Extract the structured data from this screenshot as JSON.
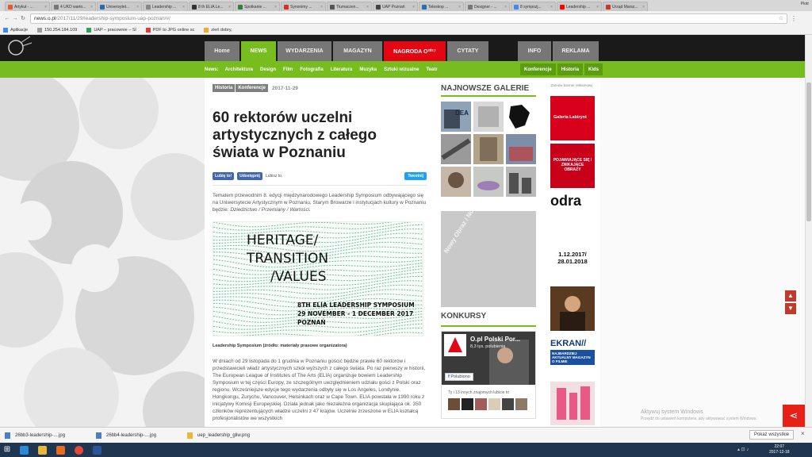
{
  "browser": {
    "tabs": [
      {
        "label": "Artykuł - ...",
        "color": "#e05a2b"
      },
      {
        "label": "4 UKD warto...",
        "color": "#777777"
      },
      {
        "label": "Universytet...",
        "color": "#2b6cb0"
      },
      {
        "label": "Leadership ...",
        "color": "#888888"
      },
      {
        "label": "8 th ELIA Le...",
        "color": "#333333"
      },
      {
        "label": "Spotkanie ...",
        "color": "#3b7a3b"
      },
      {
        "label": "Synonimy ...",
        "color": "#d93025"
      },
      {
        "label": "Tłumaczen...",
        "color": "#555555"
      },
      {
        "label": "UAP Poznań",
        "color": "#444444"
      },
      {
        "label": "Teleskop ...",
        "color": "#2b6cb0"
      },
      {
        "label": "Designer - ...",
        "color": "#777777"
      },
      {
        "label": "8 sympozj...",
        "color": "#4285f4"
      },
      {
        "label": "Leadership ...",
        "color": "#ff0000"
      },
      {
        "label": "Urząd Marsz...",
        "color": "#c0392b"
      }
    ],
    "user": "Piotr",
    "url_host": "news.o.pl",
    "url_path": "/2017/11/29/leadership-symposium-uap-poznan/#/",
    "bookmarks": [
      {
        "label": "Aplikacje",
        "color": "#4285f4"
      },
      {
        "label": "150.254.184.109",
        "color": "#9e9e9e"
      },
      {
        "label": "UAP – pracownie – Sl",
        "color": "#2aa05a"
      },
      {
        "label": "PDF to JPG online sc",
        "color": "#e53935"
      },
      {
        "label": "zień dobry,",
        "color": "#f9a825"
      }
    ]
  },
  "site": {
    "logo_text": "o.pl",
    "nav": [
      {
        "label": "Home",
        "state": "normal"
      },
      {
        "label": "NEWS",
        "state": "active"
      },
      {
        "label": "WYDARZENIA",
        "state": "normal"
      },
      {
        "label": "MAGAZYN",
        "state": "normal"
      },
      {
        "label": "NAGRODA O²⁰¹⁷",
        "state": "red"
      },
      {
        "label": "CYTATY",
        "state": "normal"
      }
    ],
    "nav_right": [
      "INFO",
      "REKLAMA"
    ],
    "subnav_label": "News:",
    "subnav": [
      "Architektura",
      "Design",
      "Film",
      "Fotografia",
      "Literatura",
      "Muzyka",
      "Sztuki wizualne",
      "Teatr"
    ],
    "subnav_right": [
      "Konferencje",
      "Historia",
      "Kids"
    ]
  },
  "article": {
    "tags": [
      "Historia",
      "Konferencje"
    ],
    "date": "2017-11-29",
    "title": "60 rektorów uczelni artystycznych z całego świata w Poznaniu",
    "like_label": "Lubię to!",
    "share_label": "Udostępnij",
    "likes_text": "Lubisz to.",
    "tweet_label": "Tweetnij",
    "lead": "Tematem przewodnim 8. edycji międzynarodowego Leadership Symposium odbywającego się na Uniwersytecie Artystycznym w Poznaniu, Starym Browarze i instytucjach kultury w Poznaniu będzie: ",
    "lead_italic": "Dziedzictwo / Przemiany / Wartości.",
    "hero": {
      "line1": "HERITAGE/",
      "line2": "TRANSITION",
      "line3": "/VALUES",
      "sub1": "8TH ELIA LEADERSHIP SYMPOSIUM",
      "sub2": "29 NOVEMBER - 1 DECEMBER 2017",
      "sub3": "POZNAŃ"
    },
    "caption": "Leadership Symposium (źródło: materiały prasowe organizatora)",
    "body": "W dniach od 29 listopada do 1 grudnia w Poznaniu gościć będzie prawie 60 rektorów i przedstawicieli władz artystycznych szkół wyższych z całego świata. Po raz pierwszy w historii, The European League of Institutes of The Arts (ELIA) organizuje bowiem Leadership Symposium w tej części Europy, ze szczególnym uwzględnieniem udziału gości z Polski oraz regionu. Wcześniejsze edycje tego wydarzenia odbyły się w Los Angeles, Londynie, Hongkongu, Zurychu, Vancouver, Helsinkach oraz w Cape Town. ELIA powstała w 1990 roku z inicjatywy Komisji Europejskiej. Działa jednak jako niezależna organizacja skupiająca ok. 350 członków reprezentujących władze uczelni z 47 krajów. Uczelnie zrzeszone w ELIA kształcą profesjonalistów we wszystkich"
  },
  "galleries": {
    "title": "NAJNOWSZE GALERIE",
    "thumbs": [
      {
        "c1": "#8fa3b8",
        "c2": "#3e4a57",
        "label": "DEA"
      },
      {
        "c1": "#d8d8d8",
        "c2": "#6b6b6b",
        "label": ""
      },
      {
        "c1": "#ffffff",
        "c2": "#111111",
        "label": ""
      },
      {
        "c1": "#9a9a9a",
        "c2": "#4a4a4a",
        "label": ""
      },
      {
        "c1": "#b4a48a",
        "c2": "#5b4c3a",
        "label": ""
      },
      {
        "c1": "#7d8ea8",
        "c2": "#c23b3b",
        "label": ""
      },
      {
        "c1": "#c6b7a8",
        "c2": "#6a5444",
        "label": ""
      },
      {
        "c1": "#c7c9c4",
        "c2": "#9d7fb6",
        "label": ""
      },
      {
        "c1": "#b8b8b8",
        "c2": "#505050",
        "label": ""
      }
    ],
    "ad_text": "Nowy Obraz / Nowe Spojrzenie 2018",
    "konkursy_title": "KONKURSY",
    "fb_page": "O.pl Polski Por...",
    "fb_likes": "8,3 tys. polubienia",
    "fb_like_btn": "Polubiono",
    "fb_friends": "Ty i 13 innych znajomych lubicie to"
  },
  "ads": {
    "label": "Zamów banner reklamowy",
    "galeria": "Galeria Labirynt",
    "odra": "odra",
    "dates1": "1.12.2017/",
    "dates2": "28.01.2018",
    "ekran": "EKRAN//",
    "ekran_sub": "NAJBARDZIEJ AKTUALNY MAGAZYN O FILMIE",
    "poj": "POJAWIAJĄCE SIĘ / ZNIKAJĄCE OBRAZY"
  },
  "windows": {
    "activate_title": "Aktywuj system Windows",
    "activate_sub": "Przejdź do ustawień komputera, aby aktywować system Windows.",
    "downloads": [
      {
        "label": "26bb3-leadership-....jpg"
      },
      {
        "label": "26bb4-leadership-....jpg"
      },
      {
        "label": "uep_leadership_gliw.png"
      }
    ],
    "show_all": "Pokaż wszystkie",
    "time": "22:07",
    "date": "2017-12-18"
  }
}
